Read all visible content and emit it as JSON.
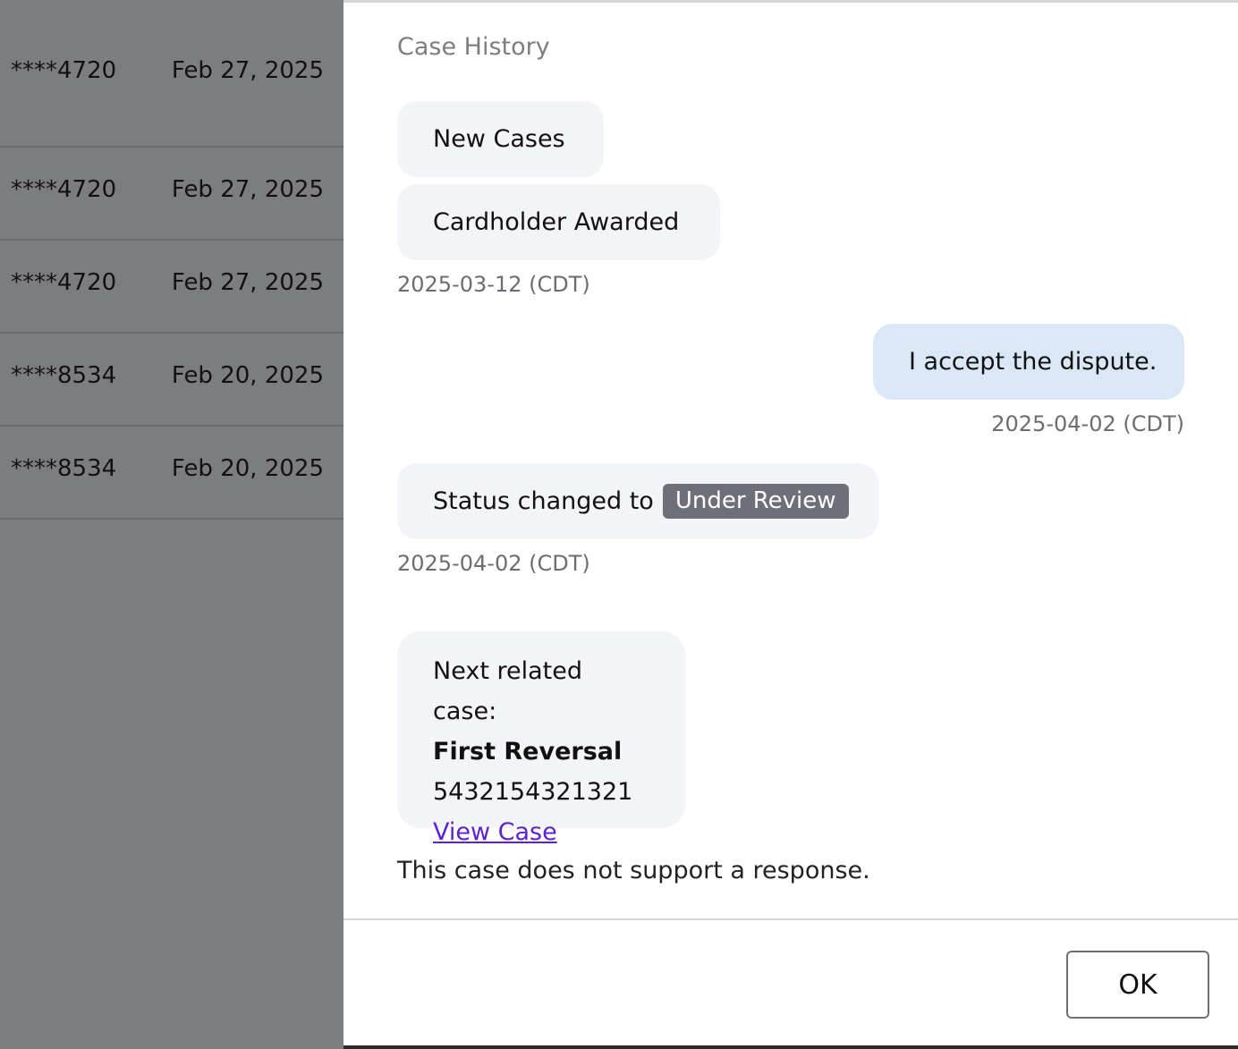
{
  "background_table": {
    "rows": [
      {
        "card": "****4720",
        "date": "Feb 27, 2025"
      },
      {
        "card": "****4720",
        "date": "Feb 27, 2025"
      },
      {
        "card": "****4720",
        "date": "Feb 27, 2025"
      },
      {
        "card": "****8534",
        "date": "Feb 20, 2025"
      },
      {
        "card": "****8534",
        "date": "Feb 20, 2025"
      }
    ]
  },
  "modal": {
    "title": "Case History",
    "events": {
      "new_cases": "New Cases",
      "cardholder_awarded": "Cardholder Awarded",
      "ts1": "2025-03-12 (CDT)",
      "accept_message": "I accept the dispute.",
      "ts2": "2025-04-02 (CDT)",
      "status_prefix": "Status changed to",
      "status_badge": "Under Review",
      "ts3": "2025-04-02 (CDT)"
    },
    "related_case": {
      "heading": "Next related case:",
      "type": "First Reversal",
      "number": "5432154321321",
      "link_label": "View Case"
    },
    "note": "This case does not support a response.",
    "ok_label": "OK"
  },
  "colors": {
    "overlay": "#7c7d80",
    "bubble": "#f3f4f8",
    "mine_bubble": "#d9e7f7",
    "badge": "#6e6f79",
    "link": "#5b21d6"
  }
}
